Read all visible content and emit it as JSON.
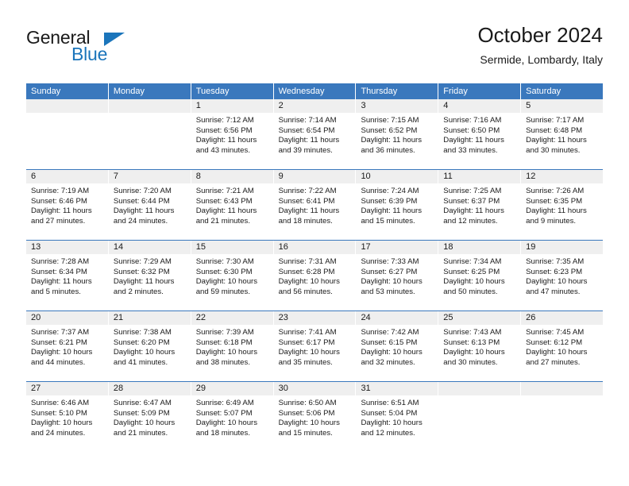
{
  "brand": {
    "name_part1": "General",
    "name_part2": "Blue",
    "triangle_color": "#1b75bb"
  },
  "header": {
    "title": "October 2024",
    "subtitle": "Sermide, Lombardy, Italy"
  },
  "theme": {
    "header_blue": "#3a78bd",
    "day_strip_gray": "#efefef",
    "text": "#1a1a1a",
    "brand_blue": "#1b75bb"
  },
  "weekdays": [
    "Sunday",
    "Monday",
    "Tuesday",
    "Wednesday",
    "Thursday",
    "Friday",
    "Saturday"
  ],
  "labels": {
    "sunrise_prefix": "Sunrise: ",
    "sunset_prefix": "Sunset: ",
    "daylight_prefix": "Daylight: "
  },
  "weeks": [
    {
      "days": [
        {
          "date": "",
          "sunrise": "",
          "sunset": "",
          "daylight": "",
          "empty": true
        },
        {
          "date": "",
          "sunrise": "",
          "sunset": "",
          "daylight": "",
          "empty": true
        },
        {
          "date": "1",
          "sunrise": "Sunrise: 7:12 AM",
          "sunset": "Sunset: 6:56 PM",
          "daylight": "Daylight: 11 hours and 43 minutes."
        },
        {
          "date": "2",
          "sunrise": "Sunrise: 7:14 AM",
          "sunset": "Sunset: 6:54 PM",
          "daylight": "Daylight: 11 hours and 39 minutes."
        },
        {
          "date": "3",
          "sunrise": "Sunrise: 7:15 AM",
          "sunset": "Sunset: 6:52 PM",
          "daylight": "Daylight: 11 hours and 36 minutes."
        },
        {
          "date": "4",
          "sunrise": "Sunrise: 7:16 AM",
          "sunset": "Sunset: 6:50 PM",
          "daylight": "Daylight: 11 hours and 33 minutes."
        },
        {
          "date": "5",
          "sunrise": "Sunrise: 7:17 AM",
          "sunset": "Sunset: 6:48 PM",
          "daylight": "Daylight: 11 hours and 30 minutes."
        }
      ]
    },
    {
      "days": [
        {
          "date": "6",
          "sunrise": "Sunrise: 7:19 AM",
          "sunset": "Sunset: 6:46 PM",
          "daylight": "Daylight: 11 hours and 27 minutes."
        },
        {
          "date": "7",
          "sunrise": "Sunrise: 7:20 AM",
          "sunset": "Sunset: 6:44 PM",
          "daylight": "Daylight: 11 hours and 24 minutes."
        },
        {
          "date": "8",
          "sunrise": "Sunrise: 7:21 AM",
          "sunset": "Sunset: 6:43 PM",
          "daylight": "Daylight: 11 hours and 21 minutes."
        },
        {
          "date": "9",
          "sunrise": "Sunrise: 7:22 AM",
          "sunset": "Sunset: 6:41 PM",
          "daylight": "Daylight: 11 hours and 18 minutes."
        },
        {
          "date": "10",
          "sunrise": "Sunrise: 7:24 AM",
          "sunset": "Sunset: 6:39 PM",
          "daylight": "Daylight: 11 hours and 15 minutes."
        },
        {
          "date": "11",
          "sunrise": "Sunrise: 7:25 AM",
          "sunset": "Sunset: 6:37 PM",
          "daylight": "Daylight: 11 hours and 12 minutes."
        },
        {
          "date": "12",
          "sunrise": "Sunrise: 7:26 AM",
          "sunset": "Sunset: 6:35 PM",
          "daylight": "Daylight: 11 hours and 9 minutes."
        }
      ]
    },
    {
      "days": [
        {
          "date": "13",
          "sunrise": "Sunrise: 7:28 AM",
          "sunset": "Sunset: 6:34 PM",
          "daylight": "Daylight: 11 hours and 5 minutes."
        },
        {
          "date": "14",
          "sunrise": "Sunrise: 7:29 AM",
          "sunset": "Sunset: 6:32 PM",
          "daylight": "Daylight: 11 hours and 2 minutes."
        },
        {
          "date": "15",
          "sunrise": "Sunrise: 7:30 AM",
          "sunset": "Sunset: 6:30 PM",
          "daylight": "Daylight: 10 hours and 59 minutes."
        },
        {
          "date": "16",
          "sunrise": "Sunrise: 7:31 AM",
          "sunset": "Sunset: 6:28 PM",
          "daylight": "Daylight: 10 hours and 56 minutes."
        },
        {
          "date": "17",
          "sunrise": "Sunrise: 7:33 AM",
          "sunset": "Sunset: 6:27 PM",
          "daylight": "Daylight: 10 hours and 53 minutes."
        },
        {
          "date": "18",
          "sunrise": "Sunrise: 7:34 AM",
          "sunset": "Sunset: 6:25 PM",
          "daylight": "Daylight: 10 hours and 50 minutes."
        },
        {
          "date": "19",
          "sunrise": "Sunrise: 7:35 AM",
          "sunset": "Sunset: 6:23 PM",
          "daylight": "Daylight: 10 hours and 47 minutes."
        }
      ]
    },
    {
      "days": [
        {
          "date": "20",
          "sunrise": "Sunrise: 7:37 AM",
          "sunset": "Sunset: 6:21 PM",
          "daylight": "Daylight: 10 hours and 44 minutes."
        },
        {
          "date": "21",
          "sunrise": "Sunrise: 7:38 AM",
          "sunset": "Sunset: 6:20 PM",
          "daylight": "Daylight: 10 hours and 41 minutes."
        },
        {
          "date": "22",
          "sunrise": "Sunrise: 7:39 AM",
          "sunset": "Sunset: 6:18 PM",
          "daylight": "Daylight: 10 hours and 38 minutes."
        },
        {
          "date": "23",
          "sunrise": "Sunrise: 7:41 AM",
          "sunset": "Sunset: 6:17 PM",
          "daylight": "Daylight: 10 hours and 35 minutes."
        },
        {
          "date": "24",
          "sunrise": "Sunrise: 7:42 AM",
          "sunset": "Sunset: 6:15 PM",
          "daylight": "Daylight: 10 hours and 32 minutes."
        },
        {
          "date": "25",
          "sunrise": "Sunrise: 7:43 AM",
          "sunset": "Sunset: 6:13 PM",
          "daylight": "Daylight: 10 hours and 30 minutes."
        },
        {
          "date": "26",
          "sunrise": "Sunrise: 7:45 AM",
          "sunset": "Sunset: 6:12 PM",
          "daylight": "Daylight: 10 hours and 27 minutes."
        }
      ]
    },
    {
      "days": [
        {
          "date": "27",
          "sunrise": "Sunrise: 6:46 AM",
          "sunset": "Sunset: 5:10 PM",
          "daylight": "Daylight: 10 hours and 24 minutes."
        },
        {
          "date": "28",
          "sunrise": "Sunrise: 6:47 AM",
          "sunset": "Sunset: 5:09 PM",
          "daylight": "Daylight: 10 hours and 21 minutes."
        },
        {
          "date": "29",
          "sunrise": "Sunrise: 6:49 AM",
          "sunset": "Sunset: 5:07 PM",
          "daylight": "Daylight: 10 hours and 18 minutes."
        },
        {
          "date": "30",
          "sunrise": "Sunrise: 6:50 AM",
          "sunset": "Sunset: 5:06 PM",
          "daylight": "Daylight: 10 hours and 15 minutes."
        },
        {
          "date": "31",
          "sunrise": "Sunrise: 6:51 AM",
          "sunset": "Sunset: 5:04 PM",
          "daylight": "Daylight: 10 hours and 12 minutes."
        },
        {
          "date": "",
          "sunrise": "",
          "sunset": "",
          "daylight": "",
          "empty": true
        },
        {
          "date": "",
          "sunrise": "",
          "sunset": "",
          "daylight": "",
          "empty": true
        }
      ]
    }
  ]
}
